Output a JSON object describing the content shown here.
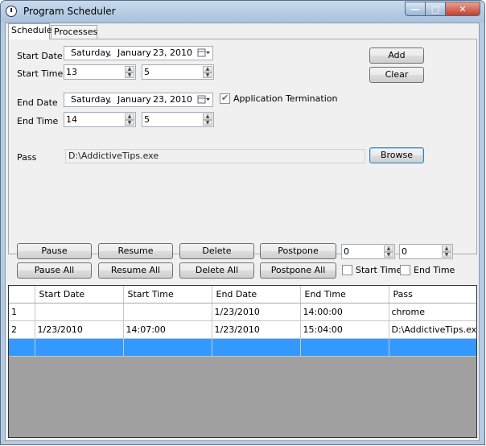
{
  "window": {
    "title": "Program Scheduler"
  },
  "tabs": [
    {
      "label": "Schedule",
      "active": true
    },
    {
      "label": "Processes",
      "active": false
    }
  ],
  "schedule": {
    "start_date_label": "Start Date",
    "start_date": {
      "weekday": "Saturday",
      "sep": ",",
      "month": "January",
      "day_year": "23, 2010"
    },
    "start_time_label": "Start Time",
    "start_hour": "13",
    "start_minute": "5",
    "end_date_label": "End Date",
    "end_date": {
      "weekday": "Saturday",
      "sep": ",",
      "month": "January",
      "day_year": "23, 2010"
    },
    "end_time_label": "End Time",
    "end_hour": "14",
    "end_minute": "5",
    "app_termination_label": "Application Termination",
    "app_termination_checked": true,
    "pass_label": "Pass",
    "pass_value": "D:\\AddictiveTips.exe",
    "add_label": "Add",
    "clear_label": "Clear",
    "browse_label": "Browse"
  },
  "actions": {
    "pause": "Pause",
    "resume": "Resume",
    "delete": "Delete",
    "postpone": "Postpone",
    "pause_all": "Pause All",
    "resume_all": "Resume All",
    "delete_all": "Delete All",
    "postpone_all": "Postpone All",
    "spin1_value": "0",
    "spin2_value": "0",
    "start_time_check": "Start Time",
    "end_time_check": "End Time"
  },
  "grid": {
    "columns": [
      "",
      "Start Date",
      "Start Time",
      "End Date",
      "End Time",
      "Pass"
    ],
    "rows": [
      [
        "1",
        "",
        "",
        "1/23/2010",
        "14:00:00",
        "chrome"
      ],
      [
        "2",
        "1/23/2010",
        "14:07:00",
        "1/23/2010",
        "15:04:00",
        "D:\\AddictiveTips.exe"
      ],
      [
        "",
        "",
        "",
        "",
        "",
        ""
      ]
    ],
    "selected_row": 2
  },
  "colors": {
    "selection": "#3399ff",
    "window_frame": "#b5cbe3",
    "close_button": "#c6402b"
  }
}
